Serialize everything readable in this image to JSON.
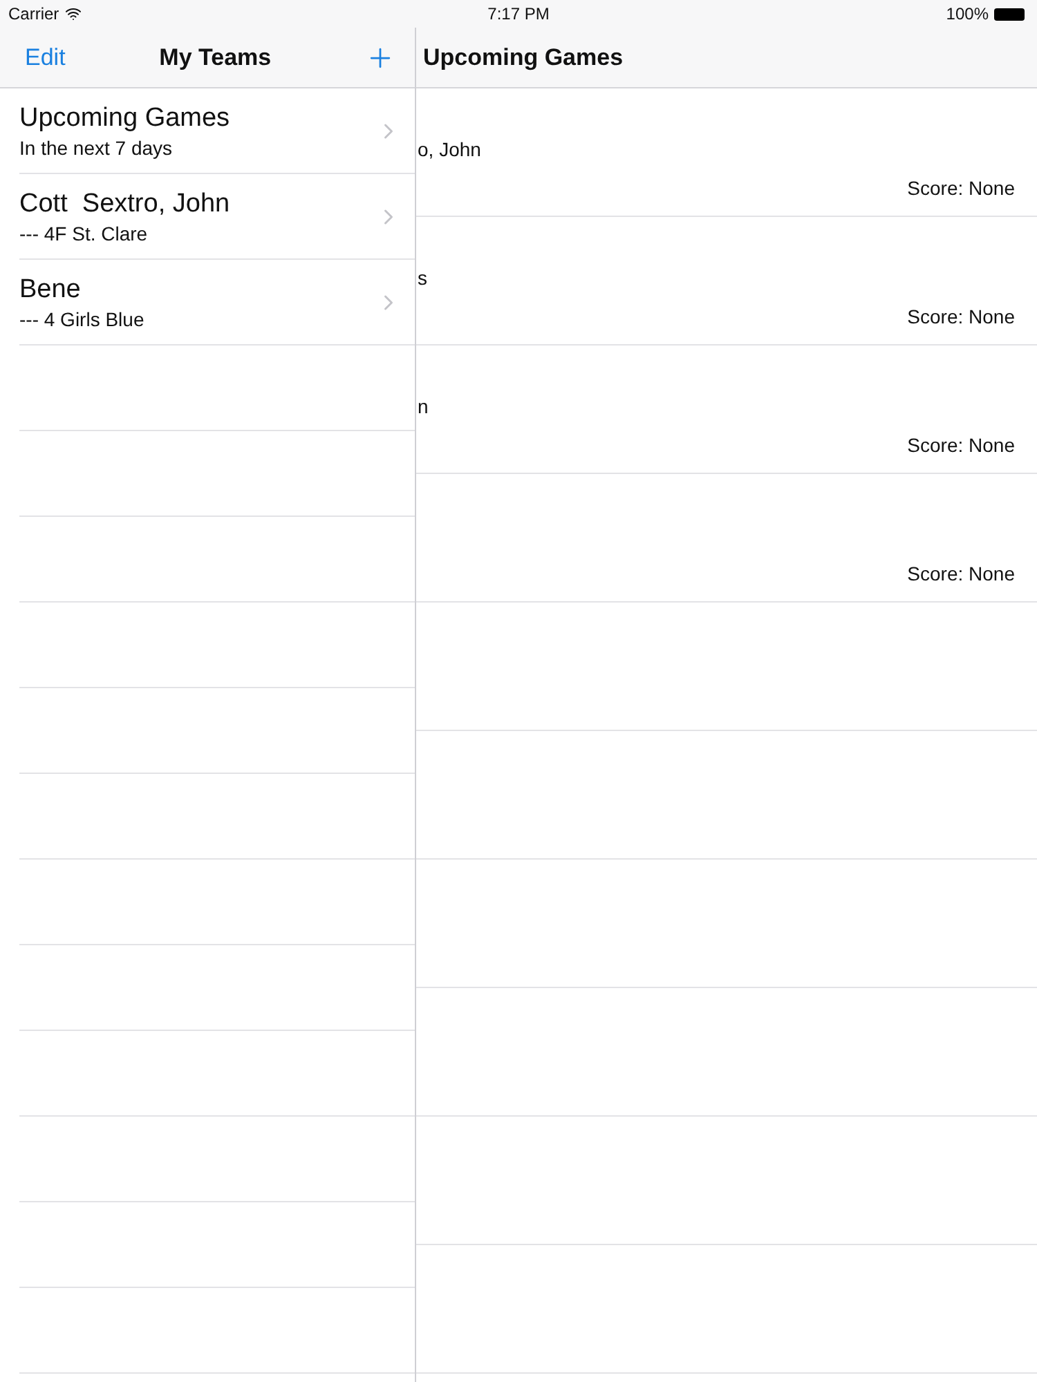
{
  "status_bar": {
    "carrier": "Carrier",
    "time": "7:17 PM",
    "battery": "100%"
  },
  "master": {
    "edit": "Edit",
    "title": "My Teams",
    "items": [
      {
        "title": "Upcoming Games",
        "subtitle": "In the next 7 days"
      },
      {
        "title": "Cott  Sextro, John",
        "subtitle": "--- 4F St. Clare"
      },
      {
        "title": "Bene",
        "subtitle": "--- 4 Girls Blue"
      }
    ]
  },
  "detail": {
    "title": "Upcoming Games",
    "games": [
      {
        "name": "o, John",
        "score": "Score: None"
      },
      {
        "name": "s",
        "score": "Score: None"
      },
      {
        "name": "n",
        "score": "Score: None"
      },
      {
        "score": "Score: None"
      }
    ]
  }
}
